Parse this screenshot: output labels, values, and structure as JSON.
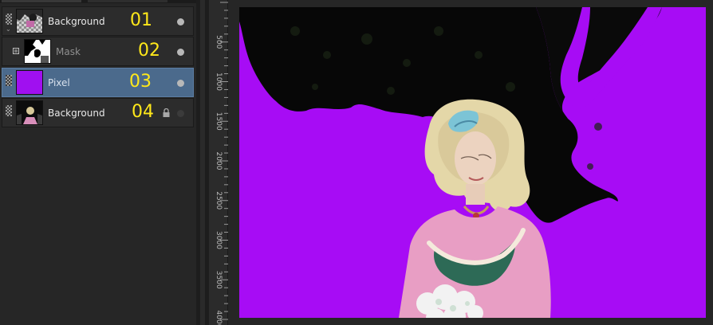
{
  "layers": [
    {
      "name": "Background",
      "number": "01",
      "thumb": "checker-group-icon",
      "visibility": "visible",
      "status": "dot"
    },
    {
      "name": "Mask",
      "number": "02",
      "thumb": "mask-thumbnail",
      "visibility": "mask",
      "status": "dot"
    },
    {
      "name": "Pixel",
      "number": "03",
      "thumb": "purple-fill",
      "visibility": "visible",
      "selected": true,
      "status": "dot"
    },
    {
      "name": "Background",
      "number": "04",
      "thumb": "photo-thumbnail",
      "visibility": "visible",
      "locked": true,
      "status": "dot-faint"
    }
  ],
  "ruler": {
    "unit_marks": [
      "500",
      "1000",
      "1500",
      "2000",
      "2500",
      "3000",
      "3500",
      "4000"
    ]
  },
  "colors": {
    "fill": "#a70cf5",
    "number_label": "#ffe81a",
    "selected_row": "#4b6a8c",
    "panel": "#262626"
  }
}
